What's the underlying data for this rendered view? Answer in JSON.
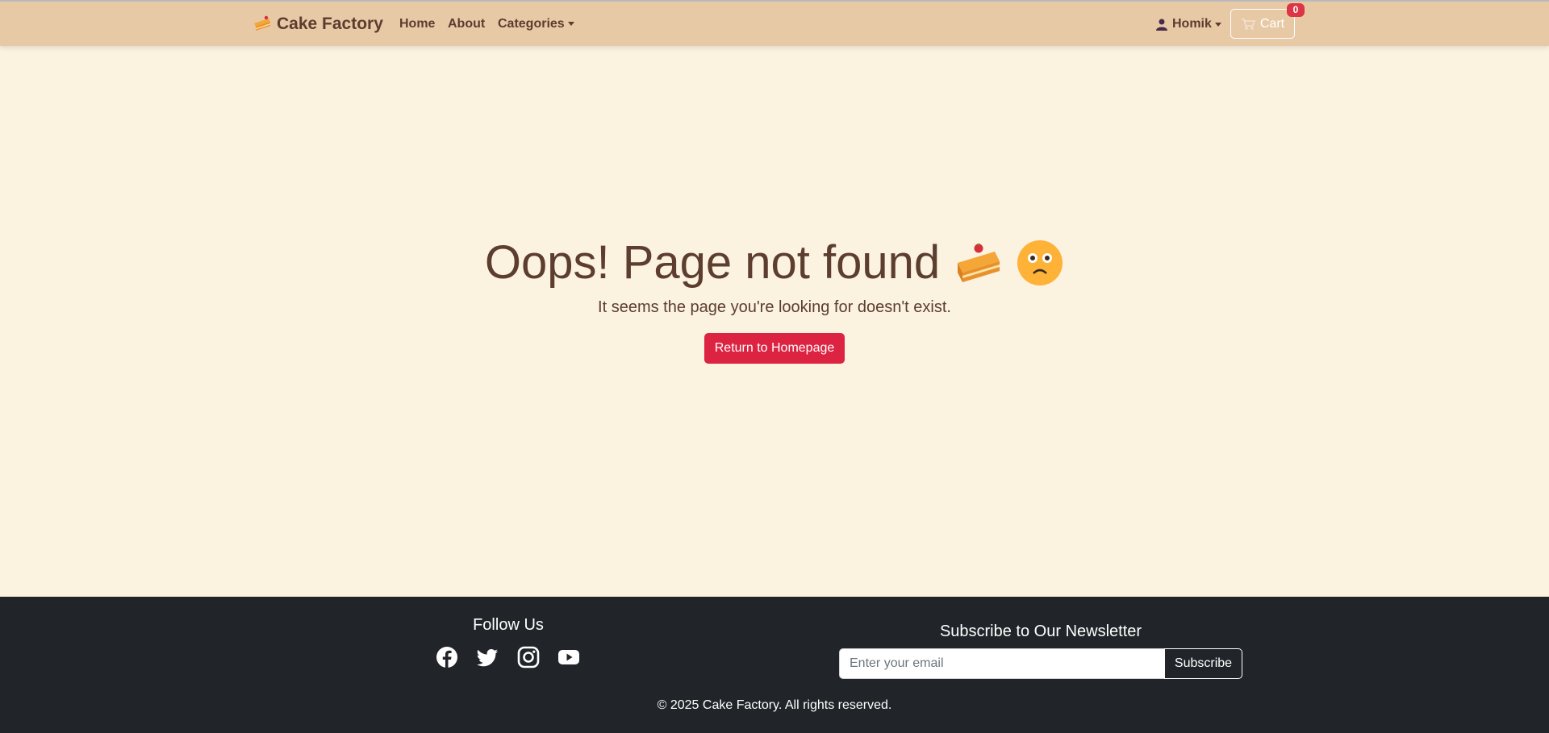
{
  "nav": {
    "brand": "Cake Factory",
    "links": [
      "Home",
      "About",
      "Categories"
    ],
    "user": "Homik",
    "cart_label": "Cart",
    "cart_count": "0"
  },
  "error": {
    "title": "Oops! Page not found",
    "subtitle": "It seems the page you're looking for doesn't exist.",
    "button": "Return to Homepage"
  },
  "footer": {
    "follow_title": "Follow Us",
    "social_icons": [
      "facebook-icon",
      "twitter-icon",
      "instagram-icon",
      "youtube-icon"
    ],
    "newsletter_title": "Subscribe to Our Newsletter",
    "email_placeholder": "Enter your email",
    "subscribe_label": "Subscribe",
    "copyright": "© 2025 Cake Factory. All rights reserved."
  },
  "colors": {
    "navbar": "#e8c9a6",
    "page_bg": "#fbf2e0",
    "text_brown": "#5c3d2e",
    "accent_red": "#dc2341",
    "footer_bg": "#212529"
  }
}
